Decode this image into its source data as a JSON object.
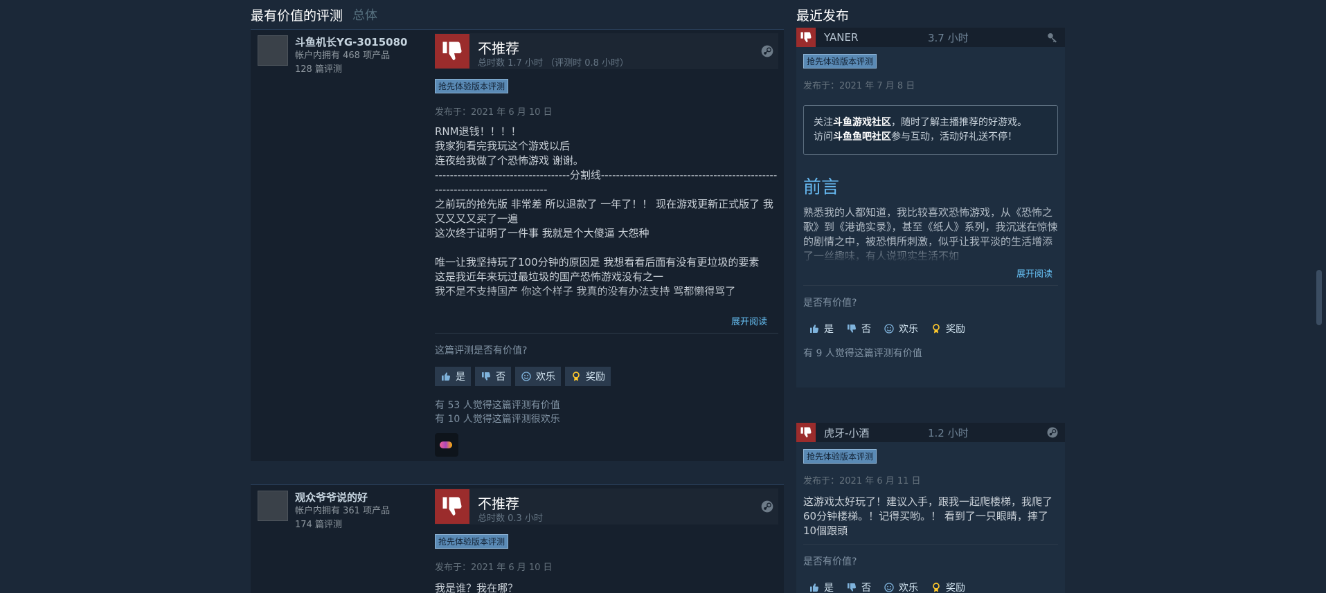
{
  "left": {
    "heading": "最有价值的评测",
    "heading_sub": "总体",
    "reviews": [
      {
        "author": "斗鱼机长YG-3015080",
        "products": "帐户内拥有 468 项产品",
        "review_count": "128 篇评测",
        "verdict": "不推荐",
        "hours": "总时数 1.7 小时 （评测时 0.8 小时）",
        "badge": "抢先体验版本评测",
        "posted": "发布于：2021 年 6 月 10 日",
        "text": "RNM退钱！！！！\n我家狗看完我玩这个游戏以后\n连夜给我做了个恐怖游戏 谢谢。\n------------------------------------分割线-----------------------------------------------------------------------------\n之前玩的抢先版 非常差 所以退款了 一年了！！ 现在游戏更新正式版了 我又又又又买了一遍\n这次终于证明了一件事 我就是个大傻逼 大怨种\n\n唯一让我坚持玩了100分钟的原因是 我想看看后面有没有更垃圾的要素\n这是我近年来玩过最垃圾的国产恐怖游戏没有之一\n我不是不支持国产 你这个样子 我真的没有办法支持 骂都懒得骂了",
        "expand": "展开阅读",
        "helpful_q": "这篇评测是否有价值?",
        "btn_yes": "是",
        "btn_no": "否",
        "btn_funny": "欢乐",
        "btn_award": "奖励",
        "stat1": "有 53 人觉得这篇评测有价值",
        "stat2": "有 10 人觉得这篇评测很欢乐"
      },
      {
        "author": "观众爷爷说的好",
        "products": "帐户内拥有 361 项产品",
        "review_count": "174 篇评测",
        "verdict": "不推荐",
        "hours": "总时数 0.3 小时",
        "badge": "抢先体验版本评测",
        "posted": "发布于：2021 年 6 月 10 日",
        "text": "我是谁？我在哪？"
      }
    ]
  },
  "right": {
    "heading": "最近发布",
    "review1": {
      "name": "YANER",
      "hours": "3.7 小时",
      "badge": "抢先体验版本评测",
      "posted": "发布于：2021 年 7 月 8 日",
      "notice_pre1": "关注",
      "notice_b1": "斗鱼游戏社区",
      "notice_post1": "，随时了解主播推荐的好游戏。",
      "notice_pre2": "访问",
      "notice_b2": "斗鱼鱼吧社区",
      "notice_post2": "参与互动，活动好礼送不停！",
      "h2": "前言",
      "text": "熟悉我的人都知道，我比较喜欢恐怖游戏，从《恐怖之歌》到《港诡实录》，甚至《纸人》系列，我沉迷在惊悚的剧情之中，被恐惧所刺激，似乎让我平淡的生活增添了一丝趣味，有人说现实生活不如",
      "expand": "展开阅读",
      "helpful_q": "是否有价值?",
      "btn_yes": "是",
      "btn_no": "否",
      "btn_funny": "欢乐",
      "btn_award": "奖励",
      "stat": "有 9 人觉得这篇评测有价值"
    },
    "review2": {
      "name": "虎牙-小酒",
      "hours": "1.2 小时",
      "badge": "抢先体验版本评测",
      "posted": "发布于：2021 年 6 月 11 日",
      "text": "这游戏太好玩了！建议入手，跟我一起爬楼梯，我爬了60分钟楼梯。！记得买哟。！ 看到了一只眼睛，摔了10個跟頭",
      "helpful_q": "是否有价值?",
      "btn_yes": "是",
      "btn_no": "否",
      "btn_funny": "欢乐",
      "btn_award": "奖励"
    }
  },
  "colors": {
    "background": "#1b2838",
    "thumb_down": "#9b2c2c",
    "link": "#67c1f5",
    "heading_blue": "#66b8f0"
  }
}
